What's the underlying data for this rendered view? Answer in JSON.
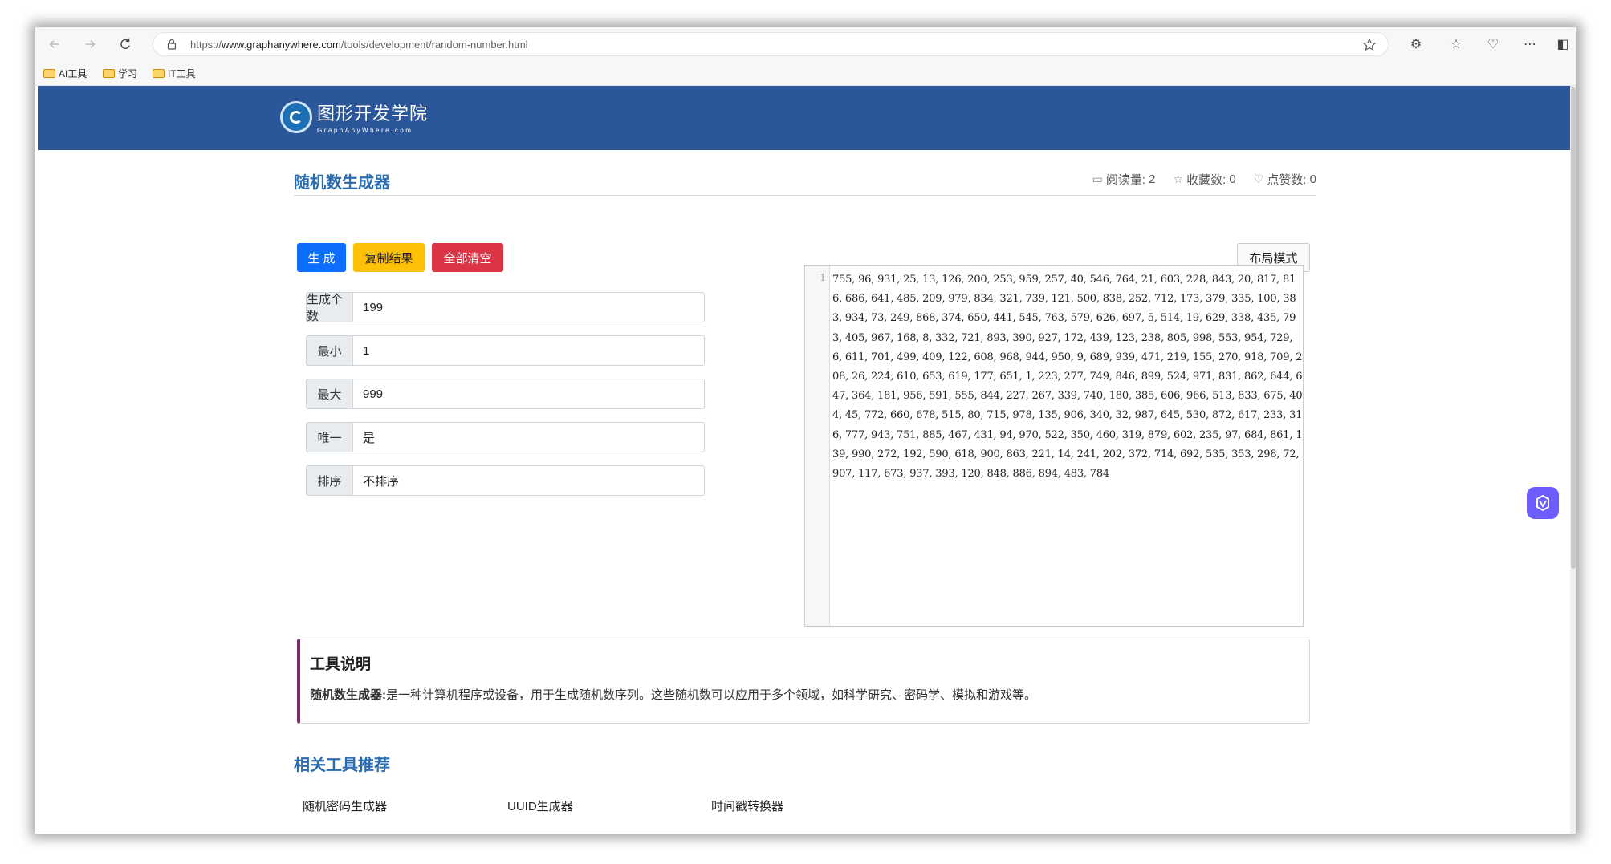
{
  "browser": {
    "url_prefix": "https://",
    "url_domain": "www.graphanywhere.com",
    "url_path": "/tools/development/random-number.html",
    "bookmarks": [
      "AI工具",
      "学习",
      "IT工具"
    ]
  },
  "site": {
    "name_cn": "图形开发学院",
    "name_en": "GraphAnyWhere.com"
  },
  "page": {
    "title": "随机数生成器",
    "stats": {
      "reads_label": "阅读量:",
      "reads_value": "2",
      "favorites_label": "收藏数:",
      "favorites_value": "0",
      "likes_label": "点赞数:",
      "likes_value": "0"
    }
  },
  "buttons": {
    "generate": "生 成",
    "copy": "复制结果",
    "clear": "全部清空",
    "layout": "布局模式"
  },
  "fields": [
    {
      "label": "生成个数",
      "value": "199"
    },
    {
      "label": "最小",
      "value": "1"
    },
    {
      "label": "最大",
      "value": "999"
    },
    {
      "label": "唯一",
      "value": "是"
    },
    {
      "label": "排序",
      "value": "不排序"
    }
  ],
  "editor": {
    "line_number": "1",
    "content": "755, 96, 931, 25, 13, 126, 200, 253, 959, 257, 40, 546, 764, 21, 603, 228, 843, 20, 817, 816, 686, 641, 485, 209, 979, 834, 321, 739, 121, 500, 838, 252, 712, 173, 379, 335, 100, 383, 934, 73, 249, 868, 374, 650, 441, 545, 763, 579, 626, 697, 5, 514, 19, 629, 338, 435, 793, 405, 967, 168, 8, 332, 721, 893, 390, 927, 172, 439, 123, 238, 805, 998, 553, 954, 729, 6, 611, 701, 499, 409, 122, 608, 968, 944, 950, 9, 689, 939, 471, 219, 155, 270, 918, 709, 208, 26, 224, 610, 653, 619, 177, 651, 1, 223, 277, 749, 846, 899, 524, 971, 831, 862, 644, 647, 364, 181, 956, 591, 555, 844, 227, 267, 339, 740, 180, 385, 606, 966, 513, 833, 675, 404, 45, 772, 660, 678, 515, 80, 715, 978, 135, 906, 340, 32, 987, 645, 530, 872, 617, 233, 316, 777, 943, 751, 885, 467, 431, 94, 970, 522, 350, 460, 319, 879, 602, 235, 97, 684, 861, 139, 990, 272, 192, 590, 618, 900, 863, 221, 14, 241, 202, 372, 714, 692, 535, 353, 298, 72, 907, 117, 673, 937, 393, 120, 848, 886, 894, 483, 784"
  },
  "description": {
    "heading": "工具说明",
    "term": "随机数生成器:",
    "text": "是一种计算机程序或设备，用于生成随机数序列。这些随机数可以应用于多个领域，如科学研究、密码学、模拟和游戏等。"
  },
  "related": {
    "title": "相关工具推荐",
    "items": [
      "随机密码生成器",
      "UUID生成器",
      "时间戳转换器"
    ]
  }
}
